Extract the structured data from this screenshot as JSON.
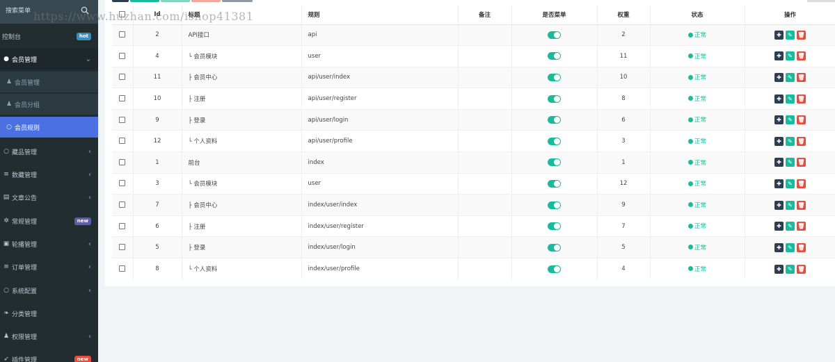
{
  "sidebar": {
    "search_placeholder": "搜索菜单",
    "items": [
      {
        "label": "控制台",
        "icon": "",
        "badge": "hot",
        "badge_color": "#3c8dbc",
        "state": "normal",
        "arrow": false
      },
      {
        "label": "会员管理",
        "icon": "user-circle-icon",
        "badge": "",
        "state": "open",
        "arrow": "down"
      },
      {
        "label": "会员管理",
        "icon": "user-icon",
        "badge": "",
        "state": "sub",
        "arrow": false
      },
      {
        "label": "会员分组",
        "icon": "users-icon",
        "badge": "",
        "state": "sub",
        "arrow": false
      },
      {
        "label": "会员规则",
        "icon": "circle-icon",
        "badge": "",
        "state": "active",
        "arrow": false
      },
      {
        "label": "藏品管理",
        "icon": "circle-icon",
        "badge": "",
        "state": "normal",
        "arrow": "left"
      },
      {
        "label": "数藏管理",
        "icon": "list-icon",
        "badge": "",
        "state": "normal",
        "arrow": "left"
      },
      {
        "label": "文章公告",
        "icon": "file-icon",
        "badge": "",
        "state": "normal",
        "arrow": "left"
      },
      {
        "label": "常规管理",
        "icon": "cogs-icon",
        "badge": "new",
        "badge_color": "#605ca8",
        "state": "normal",
        "arrow": false
      },
      {
        "label": "轮播管理",
        "icon": "image-icon",
        "badge": "",
        "state": "normal",
        "arrow": "left"
      },
      {
        "label": "订单管理",
        "icon": "list-icon",
        "badge": "",
        "state": "normal",
        "arrow": "left"
      },
      {
        "label": "系统配置",
        "icon": "circle-icon",
        "badge": "",
        "state": "normal",
        "arrow": "left"
      },
      {
        "label": "分类管理",
        "icon": "leaf-icon",
        "badge": "",
        "state": "normal",
        "arrow": false
      },
      {
        "label": "权限管理",
        "icon": "group-icon",
        "badge": "",
        "state": "normal",
        "arrow": "left"
      },
      {
        "label": "插件管理",
        "icon": "rocket-icon",
        "badge": "new",
        "badge_color": "#e74c3c",
        "state": "normal",
        "arrow": false
      }
    ]
  },
  "watermark": "https://www.huzhan.com/ishop41381",
  "table": {
    "headers": {
      "id": "Id",
      "title": "标题",
      "rule": "规则",
      "remark": "备注",
      "is_menu": "是否菜单",
      "weight": "权重",
      "status": "状态",
      "operate": "操作"
    },
    "rows": [
      {
        "id": "2",
        "title": "API接口",
        "rule": "api",
        "remark": "",
        "weight": "2",
        "status": "正常"
      },
      {
        "id": "4",
        "title": "└ 会员模块",
        "rule": "user",
        "remark": "",
        "weight": "11",
        "status": "正常"
      },
      {
        "id": "11",
        "title": "├ 会员中心",
        "rule": "api/user/index",
        "remark": "",
        "weight": "10",
        "status": "正常"
      },
      {
        "id": "10",
        "title": "├ 注册",
        "rule": "api/user/register",
        "remark": "",
        "weight": "8",
        "status": "正常"
      },
      {
        "id": "9",
        "title": "├ 登录",
        "rule": "api/user/login",
        "remark": "",
        "weight": "6",
        "status": "正常"
      },
      {
        "id": "12",
        "title": "└ 个人资料",
        "rule": "api/user/profile",
        "remark": "",
        "weight": "3",
        "status": "正常"
      },
      {
        "id": "1",
        "title": "前台",
        "rule": "index",
        "remark": "",
        "weight": "1",
        "status": "正常"
      },
      {
        "id": "3",
        "title": "└ 会员模块",
        "rule": "user",
        "remark": "",
        "weight": "12",
        "status": "正常"
      },
      {
        "id": "7",
        "title": "├ 会员中心",
        "rule": "index/user/index",
        "remark": "",
        "weight": "9",
        "status": "正常"
      },
      {
        "id": "6",
        "title": "├ 注册",
        "rule": "index/user/register",
        "remark": "",
        "weight": "7",
        "status": "正常"
      },
      {
        "id": "5",
        "title": "├ 登录",
        "rule": "index/user/login",
        "remark": "",
        "weight": "5",
        "status": "正常"
      },
      {
        "id": "8",
        "title": "└ 个人资料",
        "rule": "index/user/profile",
        "remark": "",
        "weight": "4",
        "status": "正常"
      }
    ]
  },
  "colors": {
    "sidebar_bg": "#222d32",
    "active_item": "#4b70e2",
    "success": "#18bc9c",
    "danger": "#e74c3c",
    "primary_dark": "#2c3e50"
  }
}
